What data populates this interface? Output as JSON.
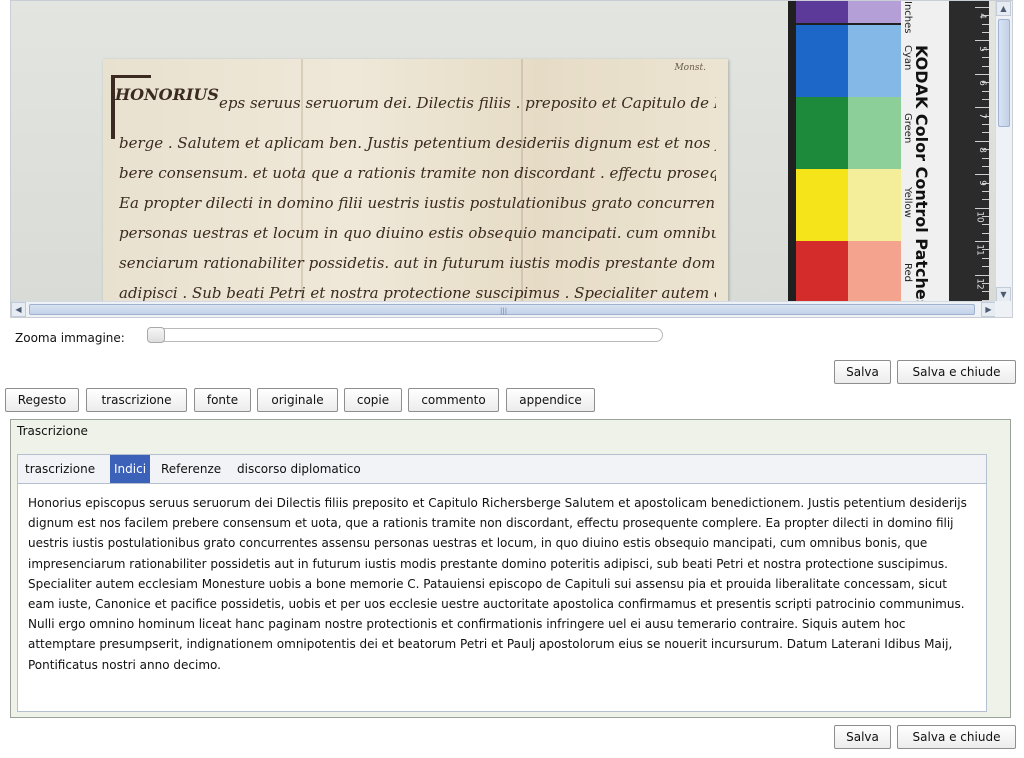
{
  "viewer": {
    "manuscript_text_lines": [
      "eps seruus seruorum dei. Dilectis filiis . preposito et Capitulo de Richers",
      "berge . Salutem et aplicam ben. Justis petentium desideriis dignum est et nos facilem pre",
      "bere consensum. et uota que a rationis tramite non discordant . effectu prosequente comple",
      "Ea propter dilecti in domino filii uestris iustis postulationibus grato concurrentes assensu .",
      "personas uestras et locum in quo diuino estis obsequio mancipati. cum omnibus bonis que impre",
      "senciarum rationabiliter possidetis. aut in futurum iustis modis prestante domino poteritis",
      "adipisci . Sub beati Petri et nostra protectione suscipimus . Specialiter autem ecclesiam de Monesture"
    ],
    "initial_text": "HONORIUS",
    "corner_note": "Monst.",
    "kodak_title": "KODAK Color Control Patches",
    "kodak_labels": [
      "Cyan",
      "Green",
      "Yellow",
      "Red"
    ],
    "kodak_top_label": "Inches",
    "ruler_numbers": [
      "4",
      "5",
      "6",
      "7",
      "8",
      "9",
      "10",
      "11",
      "12"
    ],
    "patch_colors": {
      "top_left": "#5c3a9a",
      "top_right": "#b4a0d6",
      "cyan_left": "#1d67c8",
      "cyan_right": "#84b8e6",
      "green_left": "#1c8a3a",
      "green_right": "#8ccf98",
      "yellow_left": "#f5e41a",
      "yellow_right": "#f4ee9a",
      "red_left": "#d42b2b",
      "red_right": "#f4a38e"
    },
    "scroll_icons": {
      "up": "triangle-up-icon",
      "down": "triangle-down-icon",
      "left": "triangle-left-icon",
      "right": "triangle-right-icon"
    }
  },
  "zoom": {
    "label": "Zoomа immagine:",
    "level": 0
  },
  "actions_top": {
    "save": "Salva",
    "save_close": "Salva e chiude"
  },
  "section_tabs": [
    "Regesto",
    "trascrizione",
    "fonte",
    "originale",
    "copie",
    "commento",
    "appendice"
  ],
  "panel": {
    "title": "Trascrizione",
    "tabs": [
      "trascrizione",
      "Indici",
      "Referenze",
      "discorso diplomatico"
    ],
    "active_tab": "Indici",
    "text": " Honorius episcopus seruus seruorum dei Dilectis filiis preposito et Capitulo Richersberge Salutem et apostolicam benedictionem. Justis petentium desiderijs dignum est nos facilem prebere consensum et uota, que a rationis tramite non discordant, effectu prosequente complere. Ea propter dilecti in domino filij uestris iustis postulationibus grato concurrentes assensu personas uestras et locum, in quo diuino estis obsequio mancipati, cum omnibus bonis, que impresenciarum rationabiliter possidetis aut in futurum iustis modis prestante domino poteritis adipisci, sub beati Petri et nostra protectione suscipimus. Specialiter autem ecclesiam Monesture uobis a bone memorie C. Patauiensi episcopo de Capituli sui assensu pia et prouida liberalitate concessam, sicut eam iuste, Canonice et pacifice possidetis, uobis et per uos ecclesie uestre auctoritate apostolica confirmamus et presentis scripti patrocinio communimus. Nulli ergo omnino hominum liceat hanc paginam nostre protectionis et confirmationis infringere uel ei ausu temerario contraire. Siquis autem hoc attemptare presumpserit, indignationem omnipotentis dei et beatorum Petri et Paulj apostolorum eius se nouerit incursurum. Datum Laterani Idibus Maij, Pontificatus nostri anno decimo."
  },
  "actions_bottom": {
    "save": "Salva",
    "save_close": "Salva e chiude"
  }
}
